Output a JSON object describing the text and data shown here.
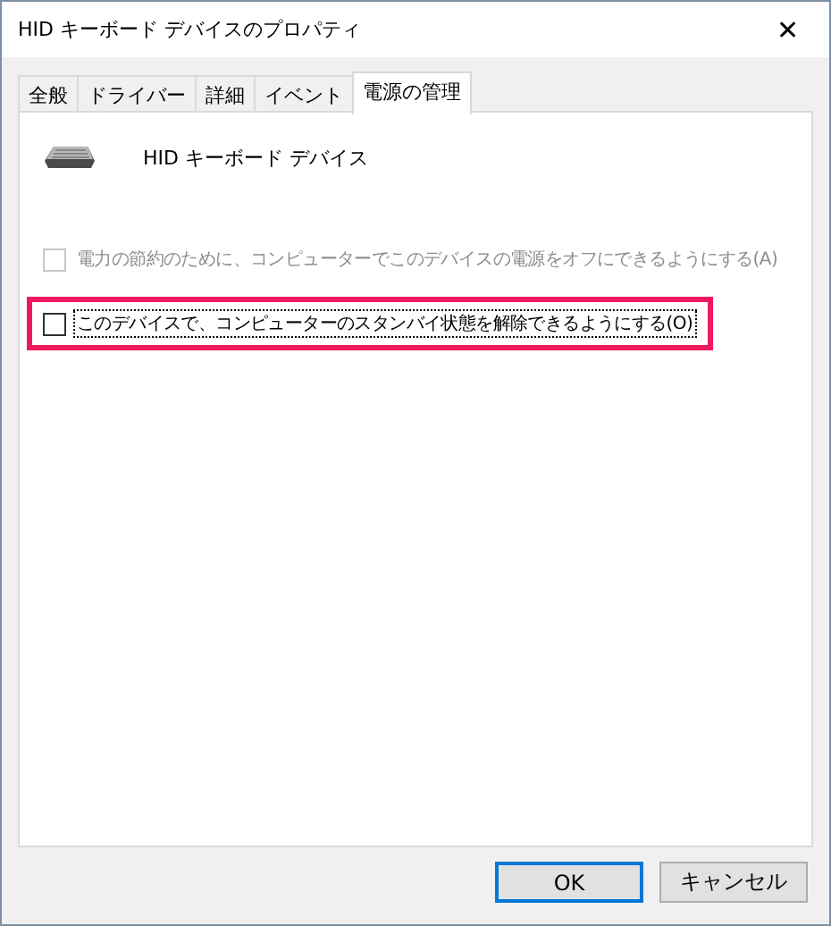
{
  "window": {
    "title": "HID キーボード デバイスのプロパティ",
    "close": "✕"
  },
  "tabs": [
    {
      "label": "全般",
      "selected": false
    },
    {
      "label": "ドライバー",
      "selected": false
    },
    {
      "label": "詳細",
      "selected": false
    },
    {
      "label": "イベント",
      "selected": false
    },
    {
      "label": "電源の管理",
      "selected": true
    }
  ],
  "device": {
    "name": "HID キーボード デバイス"
  },
  "options": [
    {
      "label": "電力の節約のために、コンピューターでこのデバイスの電源をオフにできるようにする(A)",
      "checked": false,
      "disabled": true,
      "focused": false,
      "highlighted": false
    },
    {
      "label": "このデバイスで、コンピューターのスタンバイ状態を解除できるようにする(O)",
      "checked": false,
      "disabled": false,
      "focused": true,
      "highlighted": true
    }
  ],
  "buttons": [
    {
      "label": "OK",
      "default": true
    },
    {
      "label": "キャンセル",
      "default": false
    }
  ]
}
